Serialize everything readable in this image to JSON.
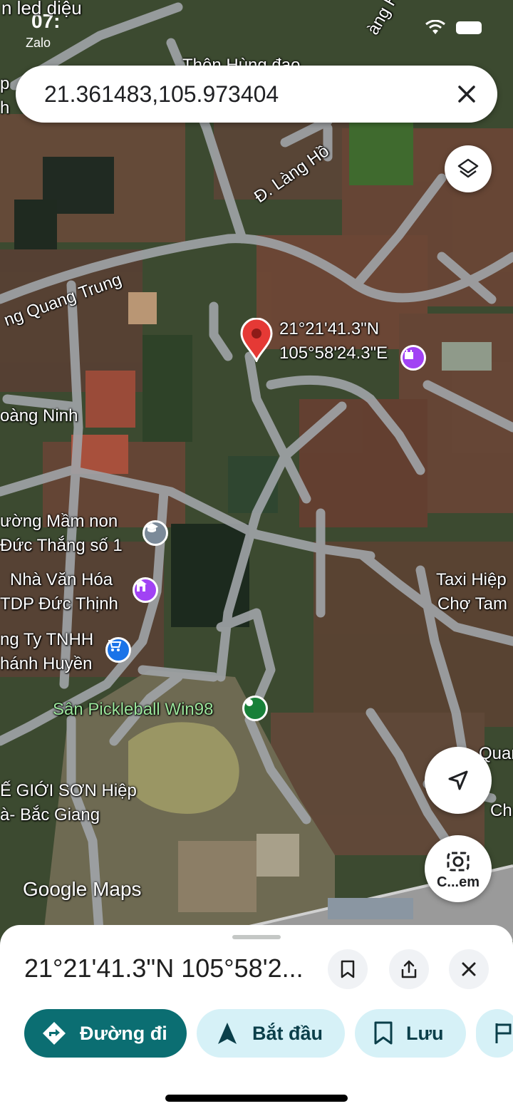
{
  "status_bar": {
    "time": "07:",
    "back_app": "Zalo"
  },
  "search": {
    "query": "21.361483,105.973404"
  },
  "pin": {
    "label_lat": "21°21'41.3\"N",
    "label_lng": "105°58'24.3\"E"
  },
  "map_labels": {
    "top_left_partial": "n led diệu",
    "top_road": "Thôn Hùng đạo",
    "lang_ho_top": "àng Hồ",
    "lang_ho": "Đ. Làng Hồ",
    "quang_trung": "ng Quang Trung",
    "hoang_ninh": "oàng Ninh",
    "mam_non_1": "ường Mầm non",
    "mam_non_2": "Đức Thắng số 1",
    "nha_van_hoa_1": "Nhà Văn Hóa",
    "nha_van_hoa_2": "TDP Đức Thịnh",
    "cong_ty_1": "ng Ty TNHH",
    "cong_ty_2": "hánh Huyền",
    "pickleball": "Sân Pickleball Win98",
    "son_hiep_1": "Ế GIỚI SƠN Hiệp",
    "son_hiep_2": "à- Bắc Giang",
    "taxi_1": "Taxi Hiệp",
    "taxi_2": "Chợ Tam",
    "quan_partial": "Quan",
    "ch_partial": "Ch",
    "p_partial": "p",
    "h_partial": "h"
  },
  "watermark": {
    "google": "Google",
    "maps": "Maps"
  },
  "camera_button": {
    "label": "C...em"
  },
  "sheet": {
    "coordinates": "21°21'41.3\"N 105°58'2...",
    "chips": [
      {
        "label": "Đường đi",
        "icon": "directions-icon"
      },
      {
        "label": "Bắt đầu",
        "icon": "navigation-arrow-icon"
      },
      {
        "label": "Lưu",
        "icon": "bookmark-icon"
      }
    ]
  },
  "colors": {
    "primary_chip": "#0b6e72",
    "secondary_chip": "#d6f1f7",
    "pin": "#e53935",
    "poi_purple": "#a142f4",
    "poi_blue": "#1a73e8",
    "poi_green": "#188038",
    "poi_gray": "#7b8a99"
  }
}
